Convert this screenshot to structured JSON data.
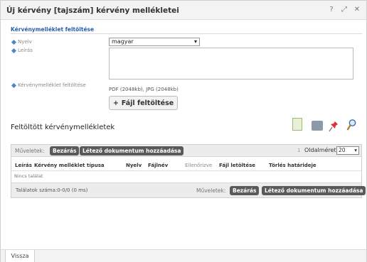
{
  "dialog": {
    "title": "Új kérvény [tajszám] kérvény mellékletei",
    "help_label": "?",
    "maximize_label": "⤢",
    "close_label": "✕"
  },
  "upload_section": {
    "heading": "Kérvénymelléklet feltöltése",
    "language_label": "Nyelv",
    "language_value": "magyar",
    "description_label": "Leírás",
    "description_value": "",
    "attachment_label": "Kérvénymelléklet feltöltése",
    "allowed_types": "PDF (2048kb), JPG (2048kb)",
    "upload_button_label": "Fájl feltöltése"
  },
  "uploaded_section": {
    "heading": "Feltöltött kérvénymellékletek",
    "toolbar": {
      "actions_label": "Műveletek:",
      "close_button": "Bezárás",
      "add_existing_button": "Létező dokumentum hozzáadása",
      "page_info": "1",
      "page_size_label": "Oldalméret",
      "page_size_value": "20"
    },
    "columns": [
      "Leírás",
      "Kérvény melléklet típusa",
      "Nyelv",
      "Fájlnév",
      "Ellenőrizve",
      "Fájl letöltése",
      "Törlés határideje"
    ],
    "empty_text": "Nincs találat",
    "footer": {
      "results_info": "Találatok száma:0-0/0 (0 ms)",
      "actions_label": "Műveletek:",
      "close_button": "Bezárás",
      "add_existing_button": "Létező dokumentum hozzáadása"
    }
  },
  "bottom": {
    "back_button": "Vissza"
  }
}
